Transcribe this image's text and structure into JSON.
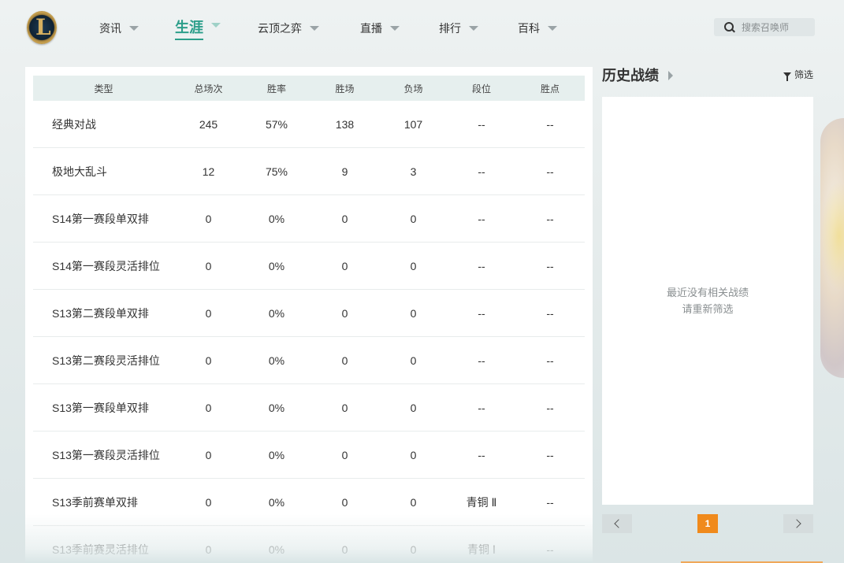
{
  "nav": {
    "items": [
      {
        "label": "资讯"
      },
      {
        "label": "生涯"
      },
      {
        "label": "云顶之弈"
      },
      {
        "label": "直播"
      },
      {
        "label": "排行"
      },
      {
        "label": "百科"
      }
    ],
    "active": "生涯"
  },
  "search": {
    "placeholder": "搜索召唤师"
  },
  "table": {
    "headers": [
      "类型",
      "总场次",
      "胜率",
      "胜场",
      "负场",
      "段位",
      "胜点"
    ],
    "rows": [
      [
        "经典对战",
        "245",
        "57%",
        "138",
        "107",
        "--",
        "--"
      ],
      [
        "极地大乱斗",
        "12",
        "75%",
        "9",
        "3",
        "--",
        "--"
      ],
      [
        "S14第一赛段单双排",
        "0",
        "0%",
        "0",
        "0",
        "--",
        "--"
      ],
      [
        "S14第一赛段灵活排位",
        "0",
        "0%",
        "0",
        "0",
        "--",
        "--"
      ],
      [
        "S13第二赛段单双排",
        "0",
        "0%",
        "0",
        "0",
        "--",
        "--"
      ],
      [
        "S13第二赛段灵活排位",
        "0",
        "0%",
        "0",
        "0",
        "--",
        "--"
      ],
      [
        "S13第一赛段单双排",
        "0",
        "0%",
        "0",
        "0",
        "--",
        "--"
      ],
      [
        "S13第一赛段灵活排位",
        "0",
        "0%",
        "0",
        "0",
        "--",
        "--"
      ],
      [
        "S13季前赛单双排",
        "0",
        "0%",
        "0",
        "0",
        "青铜 Ⅱ",
        "--"
      ],
      [
        "S13季前赛灵活排位",
        "0",
        "0%",
        "0",
        "0",
        "青铜 Ⅰ",
        "--"
      ]
    ]
  },
  "history": {
    "title": "历史战绩",
    "filter_label": "筛选",
    "empty_line1": "最近没有相关战绩",
    "empty_line2": "请重新筛选",
    "current_page": "1"
  },
  "colors": {
    "accent": "#2c9e8a",
    "page_active": "#f08a1c",
    "table_header_bg": "#e6efee"
  },
  "icons": [
    "lol-logo-icon",
    "search-icon",
    "filter-icon",
    "chevron-left-icon",
    "chevron-right-icon",
    "caret-down-icon",
    "caret-right-icon"
  ]
}
